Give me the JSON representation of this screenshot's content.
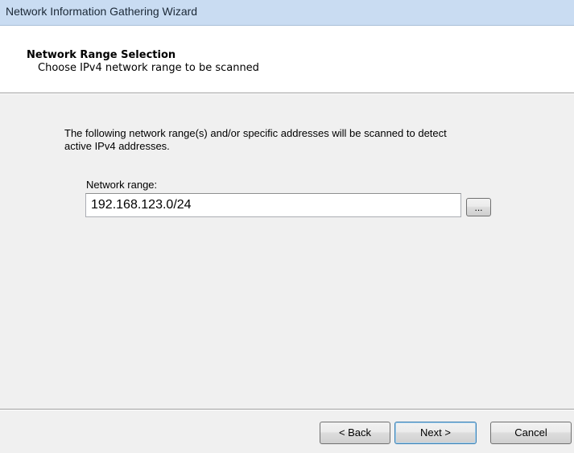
{
  "window": {
    "title": "Network Information Gathering Wizard"
  },
  "header": {
    "title": "Network Range Selection",
    "subtitle": "Choose IPv4 network range to be scanned"
  },
  "body": {
    "description_line1": "The following network range(s) and/or specific addresses will be scanned to detect",
    "description_line2": "active IPv4 addresses.",
    "range_label": "Network range:",
    "range_value": "192.168.123.0/24",
    "browse_label": "..."
  },
  "footer": {
    "back_label": "< Back",
    "next_label": "Next >",
    "cancel_label": "Cancel"
  }
}
